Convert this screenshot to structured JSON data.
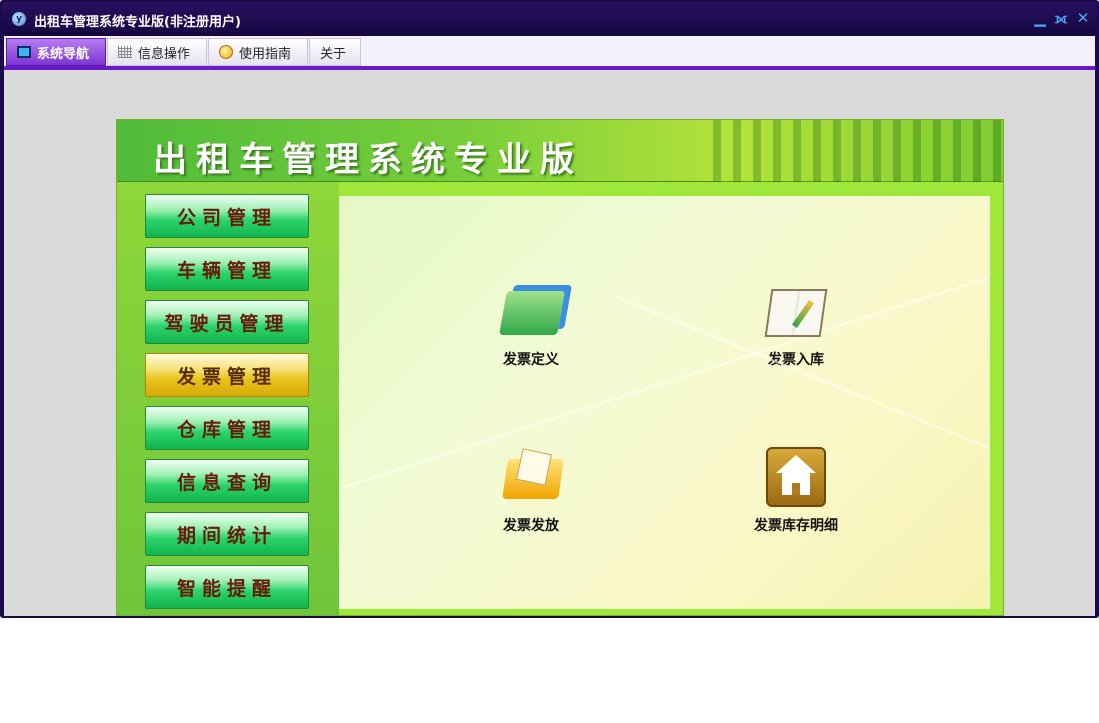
{
  "window": {
    "title": "出租车管理系统专业版(非注册用户)",
    "controls": {
      "minimize": "▁",
      "restore": "⟗",
      "close": "✕"
    }
  },
  "menu": {
    "tabs": [
      {
        "label": "系统导航",
        "icon": "monitor-icon",
        "active": true
      },
      {
        "label": "信息操作",
        "icon": "grid-icon",
        "active": false
      },
      {
        "label": "使用指南",
        "icon": "help-icon",
        "active": false
      },
      {
        "label": "关于",
        "icon": "",
        "active": false
      }
    ]
  },
  "panel": {
    "banner_title": "出租车管理系统专业版",
    "nav": [
      {
        "label": "公司管理",
        "active": false
      },
      {
        "label": "车辆管理",
        "active": false
      },
      {
        "label": "驾驶员管理",
        "active": false
      },
      {
        "label": "发票管理",
        "active": true
      },
      {
        "label": "仓库管理",
        "active": false
      },
      {
        "label": "信息查询",
        "active": false
      },
      {
        "label": "期间统计",
        "active": false
      },
      {
        "label": "智能提醒",
        "active": false
      }
    ],
    "features": [
      {
        "label": "发票定义",
        "icon": "folders-icon"
      },
      {
        "label": "发票入库",
        "icon": "book-icon"
      },
      {
        "label": "发票发放",
        "icon": "folder-icon"
      },
      {
        "label": "发票库存明细",
        "icon": "house-icon"
      }
    ]
  },
  "colors": {
    "titlebar": "#1a0a4a",
    "menu_accent": "#6a1ac8",
    "nav_green": "#2ad36a",
    "nav_active_gold": "#e8c41a"
  }
}
